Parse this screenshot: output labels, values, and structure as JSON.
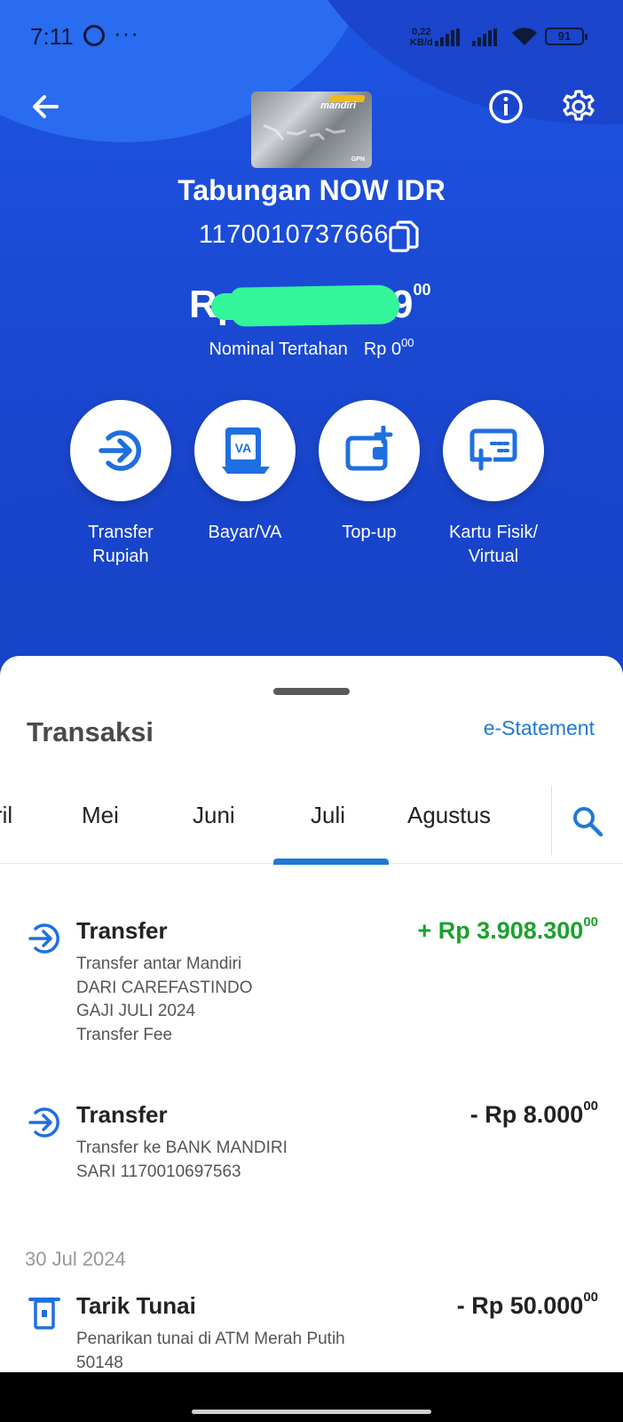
{
  "status_bar": {
    "time": "7:11",
    "net_speed_value": "0,22",
    "net_speed_unit": "KB/d",
    "battery": "91"
  },
  "header": {
    "card_brand": "mandiri",
    "card_network": "GPN",
    "account_name": "Tabungan NOW IDR",
    "account_number": "1170010737666",
    "balance_prefix": "Rp",
    "balance_visible_tail": "9",
    "balance_decimal": "00",
    "hold_label": "Nominal Tertahan",
    "hold_value": "Rp 0",
    "hold_decimal": "00"
  },
  "quick_actions": [
    {
      "label": "Transfer\nRupiah",
      "icon": "transfer-arrow-icon"
    },
    {
      "label": "Bayar/VA",
      "icon": "va-bill-icon"
    },
    {
      "label": "Top-up",
      "icon": "wallet-plus-icon"
    },
    {
      "label": "Kartu Fisik/\nVirtual",
      "icon": "card-plus-icon"
    }
  ],
  "transactions_panel": {
    "title": "Transaksi",
    "estatement_label": "e-Statement",
    "month_tabs": [
      "ril",
      "Mei",
      "Juni",
      "Juli",
      "Agustus"
    ],
    "active_tab": "Juli",
    "items": [
      {
        "title": "Transfer",
        "amount": "+ Rp 3.908.300",
        "amount_decimal": "00",
        "direction": "in",
        "description": [
          "Transfer antar Mandiri",
          "DARI CAREFASTINDO",
          "GAJI JULI 2024",
          "Transfer Fee"
        ]
      },
      {
        "title": "Transfer",
        "amount": "- Rp 8.000",
        "amount_decimal": "00",
        "direction": "out",
        "description": [
          "Transfer ke BANK MANDIRI",
          "SARI 1170010697563"
        ]
      }
    ],
    "date_separator": "30 Jul 2024",
    "items_after_date": [
      {
        "title": "Tarik Tunai",
        "amount": "- Rp 50.000",
        "amount_decimal": "00",
        "direction": "out",
        "description": [
          "Penarikan tunai di ATM Merah Putih",
          "50148"
        ]
      }
    ]
  },
  "colors": {
    "primary_blue": "#1a47d0",
    "accent_blue": "#1f7ad6",
    "incoming_green": "#1ba12d",
    "mask_green": "#33f59a"
  }
}
